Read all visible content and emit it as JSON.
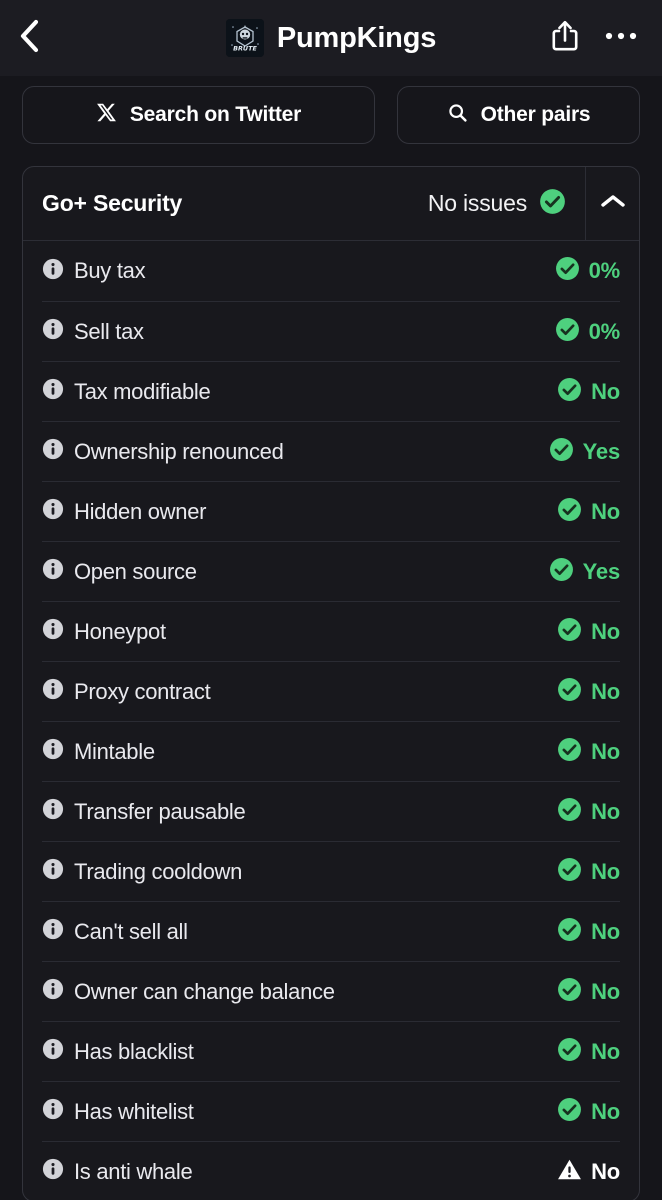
{
  "topbar": {
    "back_icon": "chevron-left-icon",
    "token_name": "PumpKings",
    "logo_icon": "token-logo",
    "share_icon": "share-icon",
    "more_icon": "more-horizontal-icon"
  },
  "actions": {
    "search_twitter": {
      "label": "Search on Twitter",
      "icon": "x-twitter-icon"
    },
    "other_pairs": {
      "label": "Other pairs",
      "icon": "search-icon"
    }
  },
  "security": {
    "title": "Go+ Security",
    "status_text": "No issues",
    "status_icon": "check-circle-icon",
    "collapse_icon": "chevron-up-icon",
    "accent_ok": "#4ed07e",
    "accent_warn": "#ffffff",
    "rows": [
      {
        "label": "Buy tax",
        "value": "0%",
        "icon": "check-circle-icon",
        "state": "ok"
      },
      {
        "label": "Sell tax",
        "value": "0%",
        "icon": "check-circle-icon",
        "state": "ok"
      },
      {
        "label": "Tax modifiable",
        "value": "No",
        "icon": "check-circle-icon",
        "state": "ok"
      },
      {
        "label": "Ownership renounced",
        "value": "Yes",
        "icon": "check-circle-icon",
        "state": "ok"
      },
      {
        "label": "Hidden owner",
        "value": "No",
        "icon": "check-circle-icon",
        "state": "ok"
      },
      {
        "label": "Open source",
        "value": "Yes",
        "icon": "check-circle-icon",
        "state": "ok"
      },
      {
        "label": "Honeypot",
        "value": "No",
        "icon": "check-circle-icon",
        "state": "ok"
      },
      {
        "label": "Proxy contract",
        "value": "No",
        "icon": "check-circle-icon",
        "state": "ok"
      },
      {
        "label": "Mintable",
        "value": "No",
        "icon": "check-circle-icon",
        "state": "ok"
      },
      {
        "label": "Transfer pausable",
        "value": "No",
        "icon": "check-circle-icon",
        "state": "ok"
      },
      {
        "label": "Trading cooldown",
        "value": "No",
        "icon": "check-circle-icon",
        "state": "ok"
      },
      {
        "label": "Can't sell all",
        "value": "No",
        "icon": "check-circle-icon",
        "state": "ok"
      },
      {
        "label": "Owner can change balance",
        "value": "No",
        "icon": "check-circle-icon",
        "state": "ok"
      },
      {
        "label": "Has blacklist",
        "value": "No",
        "icon": "check-circle-icon",
        "state": "ok"
      },
      {
        "label": "Has whitelist",
        "value": "No",
        "icon": "check-circle-icon",
        "state": "ok"
      },
      {
        "label": "Is anti whale",
        "value": "No",
        "icon": "warning-triangle-icon",
        "state": "warn"
      }
    ],
    "row_info_icon": "info-icon"
  }
}
